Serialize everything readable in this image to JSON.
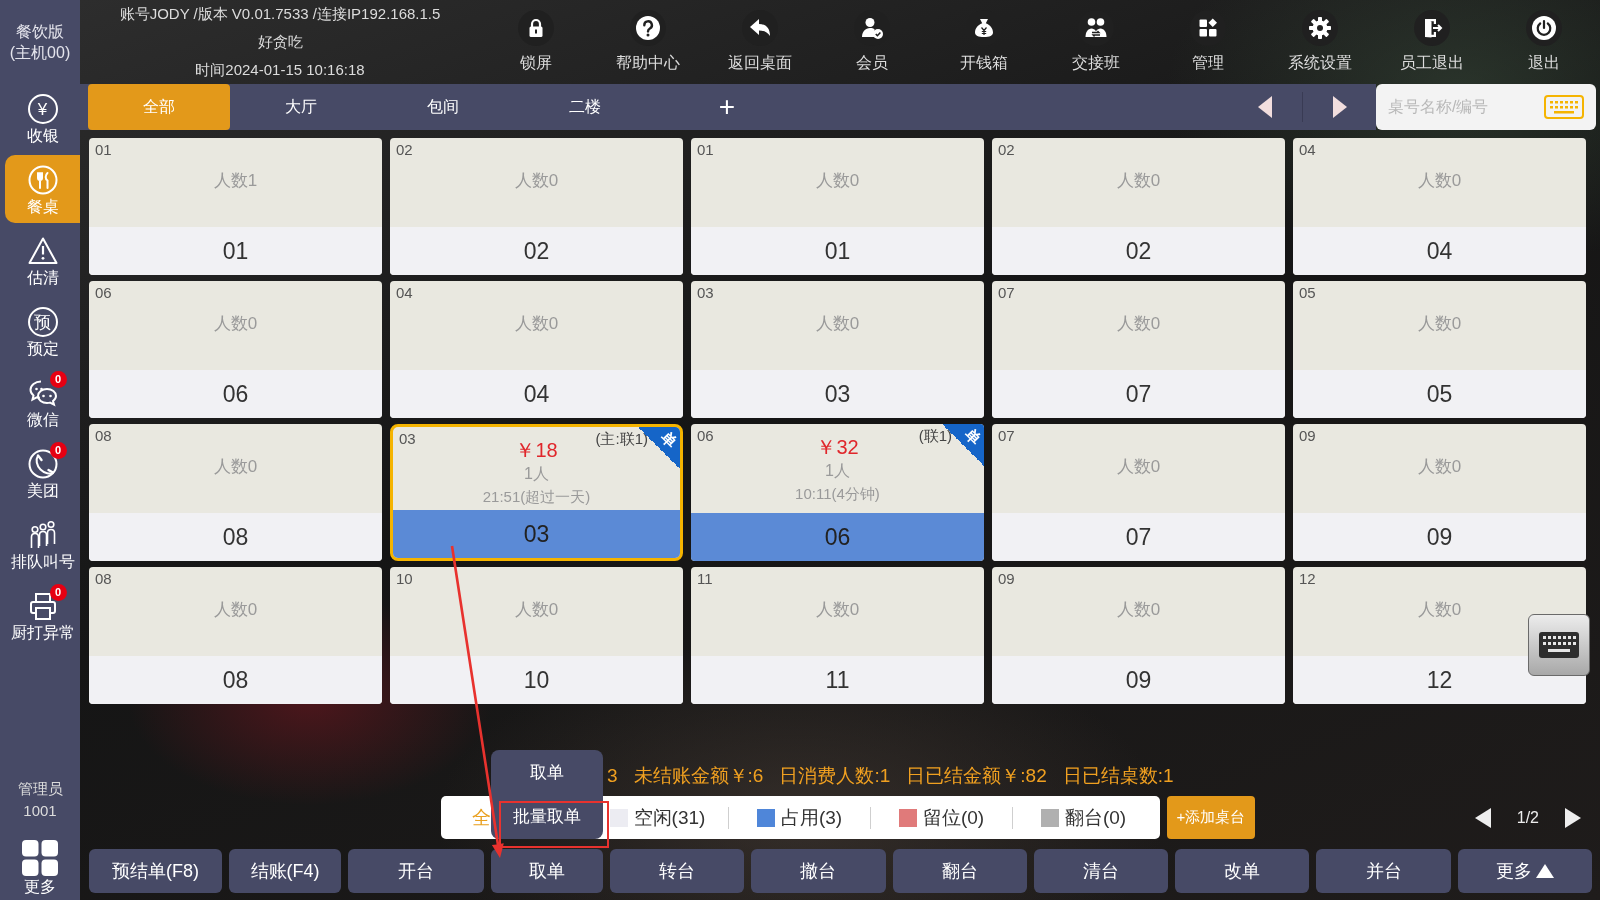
{
  "sidebar": {
    "edition": "餐饮版",
    "host": "(主机00)",
    "items": [
      {
        "label": "收银",
        "glyph": "¥",
        "selected": false
      },
      {
        "label": "餐桌",
        "selected": true
      },
      {
        "label": "估清",
        "selected": false
      },
      {
        "label": "预定",
        "glyph": "预",
        "selected": false
      },
      {
        "label": "微信",
        "badge": "0",
        "selected": false
      },
      {
        "label": "美团",
        "badge": "0",
        "selected": false
      },
      {
        "label": "排队叫号",
        "selected": false
      },
      {
        "label": "厨打异常",
        "badge": "0",
        "selected": false
      }
    ],
    "user": {
      "role": "管理员",
      "id": "1001"
    },
    "more": "更多"
  },
  "header": {
    "info": [
      "账号JODY /版本 V0.01.7533 /连接IP192.168.1.5",
      "好贪吃",
      "时间2024-01-15 10:16:18"
    ],
    "actions": [
      "锁屏",
      "帮助中心",
      "返回桌面",
      "会员",
      "开钱箱",
      "交接班",
      "管理",
      "系统设置",
      "员工退出",
      "退出"
    ]
  },
  "area_tabs": [
    {
      "label": "全部",
      "selected": true
    },
    {
      "label": "大厅",
      "selected": false
    },
    {
      "label": "包间",
      "selected": false
    },
    {
      "label": "二楼",
      "selected": false
    }
  ],
  "add_area": "+",
  "search": {
    "placeholder": "桌号名称/编号"
  },
  "tables": [
    {
      "number": "01",
      "name": "01",
      "kind": "idle",
      "guests": "人数1",
      "selected": false
    },
    {
      "number": "02",
      "name": "02",
      "kind": "idle",
      "guests": "人数0",
      "selected": false
    },
    {
      "number": "01",
      "name": "01",
      "kind": "idle",
      "guests": "人数0",
      "selected": false
    },
    {
      "number": "02",
      "name": "02",
      "kind": "idle",
      "guests": "人数0",
      "selected": false
    },
    {
      "number": "04",
      "name": "04",
      "kind": "idle",
      "guests": "人数0",
      "selected": false
    },
    {
      "number": "06",
      "name": "06",
      "kind": "idle",
      "guests": "人数0",
      "selected": false
    },
    {
      "number": "04",
      "name": "04",
      "kind": "idle",
      "guests": "人数0",
      "selected": false
    },
    {
      "number": "03",
      "name": "03",
      "kind": "idle",
      "guests": "人数0",
      "selected": false
    },
    {
      "number": "07",
      "name": "07",
      "kind": "idle",
      "guests": "人数0",
      "selected": false
    },
    {
      "number": "05",
      "name": "05",
      "kind": "idle",
      "guests": "人数0",
      "selected": false
    },
    {
      "number": "08",
      "name": "08",
      "kind": "idle",
      "guests": "人数0",
      "selected": false
    },
    {
      "number": "03",
      "name": "03",
      "kind": "occupied",
      "amount": "￥18",
      "link": "(主:联1)",
      "ribbon": "单",
      "guests": "1人",
      "time": "21:51(超过一天)",
      "selected": true
    },
    {
      "number": "06",
      "name": "06",
      "kind": "occupied",
      "amount": "￥32",
      "link": "(联1)",
      "ribbon": "单",
      "guests": "1人",
      "time": "10:11(4分钟)",
      "selected": false
    },
    {
      "number": "07",
      "name": "07",
      "kind": "idle",
      "guests": "人数0",
      "selected": false
    },
    {
      "number": "09",
      "name": "09",
      "kind": "idle",
      "guests": "人数0",
      "selected": false
    },
    {
      "number": "08",
      "name": "08",
      "kind": "idle",
      "guests": "人数0",
      "selected": false
    },
    {
      "number": "10",
      "name": "10",
      "kind": "idle",
      "guests": "人数0",
      "selected": false
    },
    {
      "number": "11",
      "name": "11",
      "kind": "idle",
      "guests": "人数0",
      "selected": false
    },
    {
      "number": "09",
      "name": "09",
      "kind": "idle",
      "guests": "人数0",
      "selected": false
    },
    {
      "number": "12",
      "name": "12",
      "kind": "idle",
      "guests": "人数0",
      "selected": false
    }
  ],
  "stats": [
    "3",
    "未结账金额￥:6",
    "日消费人数:1",
    "日已结金额￥:82",
    "日已结桌数:1"
  ],
  "legend": [
    {
      "label": "全",
      "selected": true
    },
    {
      "label": "空闲(31)",
      "color": "#ececf2",
      "selected": false
    },
    {
      "label": "占用(3)",
      "color": "#4f86d9",
      "selected": false
    },
    {
      "label": "留位(0)",
      "color": "#e07a7a",
      "selected": false
    },
    {
      "label": "翻台(0)",
      "color": "#b0b0b0",
      "selected": false
    }
  ],
  "add_table": "+添加桌台",
  "pager": "1/2",
  "actions": [
    {
      "label": "预结单(F8)",
      "kind": "plain"
    },
    {
      "label": "结账(F4)",
      "kind": "plain"
    },
    {
      "label": "开台",
      "kind": "plain"
    },
    {
      "label": "取单",
      "kind": "plain"
    },
    {
      "label": "转台",
      "kind": "plain"
    },
    {
      "label": "撤台",
      "kind": "plain"
    },
    {
      "label": "翻台",
      "kind": "plain"
    },
    {
      "label": "清台",
      "kind": "plain"
    },
    {
      "label": "改单",
      "kind": "plain"
    },
    {
      "label": "并台",
      "kind": "plain"
    },
    {
      "label": "更多",
      "kind": "menu"
    }
  ],
  "popup_menu": [
    "取单",
    "批量取单"
  ],
  "annotations": [
    {
      "kind": "arrow"
    },
    {
      "kind": "frame"
    }
  ]
}
